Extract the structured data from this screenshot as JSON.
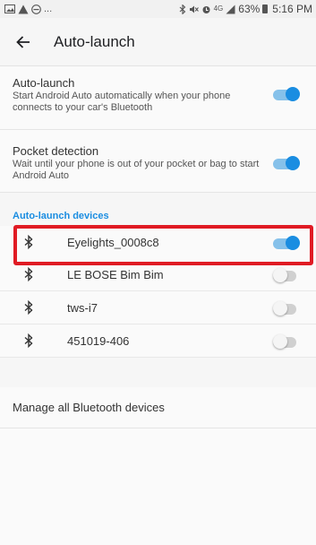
{
  "status_bar": {
    "left_icons": [
      "gallery-icon",
      "warning-icon",
      "do-not-disturb-icon"
    ],
    "left_ellipsis": "...",
    "network_label": "4G",
    "battery_percent": "63%",
    "time": "5:16 PM"
  },
  "app_bar": {
    "title": "Auto-launch",
    "back_icon": "arrow-left-icon"
  },
  "settings": {
    "auto_launch": {
      "title": "Auto-launch",
      "subtitle": "Start Android Auto automatically when your phone connects to your car's Bluetooth",
      "enabled": true
    },
    "pocket_detection": {
      "title": "Pocket detection",
      "subtitle": "Wait until your phone is out of your pocket or bag to start Android Auto",
      "enabled": true
    }
  },
  "devices_section": {
    "header": "Auto-launch devices",
    "devices": [
      {
        "name": "Eyelights_0008c8",
        "icon": "bluetooth-icon",
        "enabled": true
      },
      {
        "name": "LE BOSE Bim Bim",
        "icon": "bluetooth-icon",
        "enabled": false
      },
      {
        "name": "tws-i7",
        "icon": "bluetooth-icon",
        "enabled": false
      },
      {
        "name": "451019-406",
        "icon": "bluetooth-icon",
        "enabled": false
      }
    ]
  },
  "manage_link": "Manage all Bluetooth devices",
  "colors": {
    "accent": "#1a8de1",
    "highlight_border": "#e01b24"
  }
}
